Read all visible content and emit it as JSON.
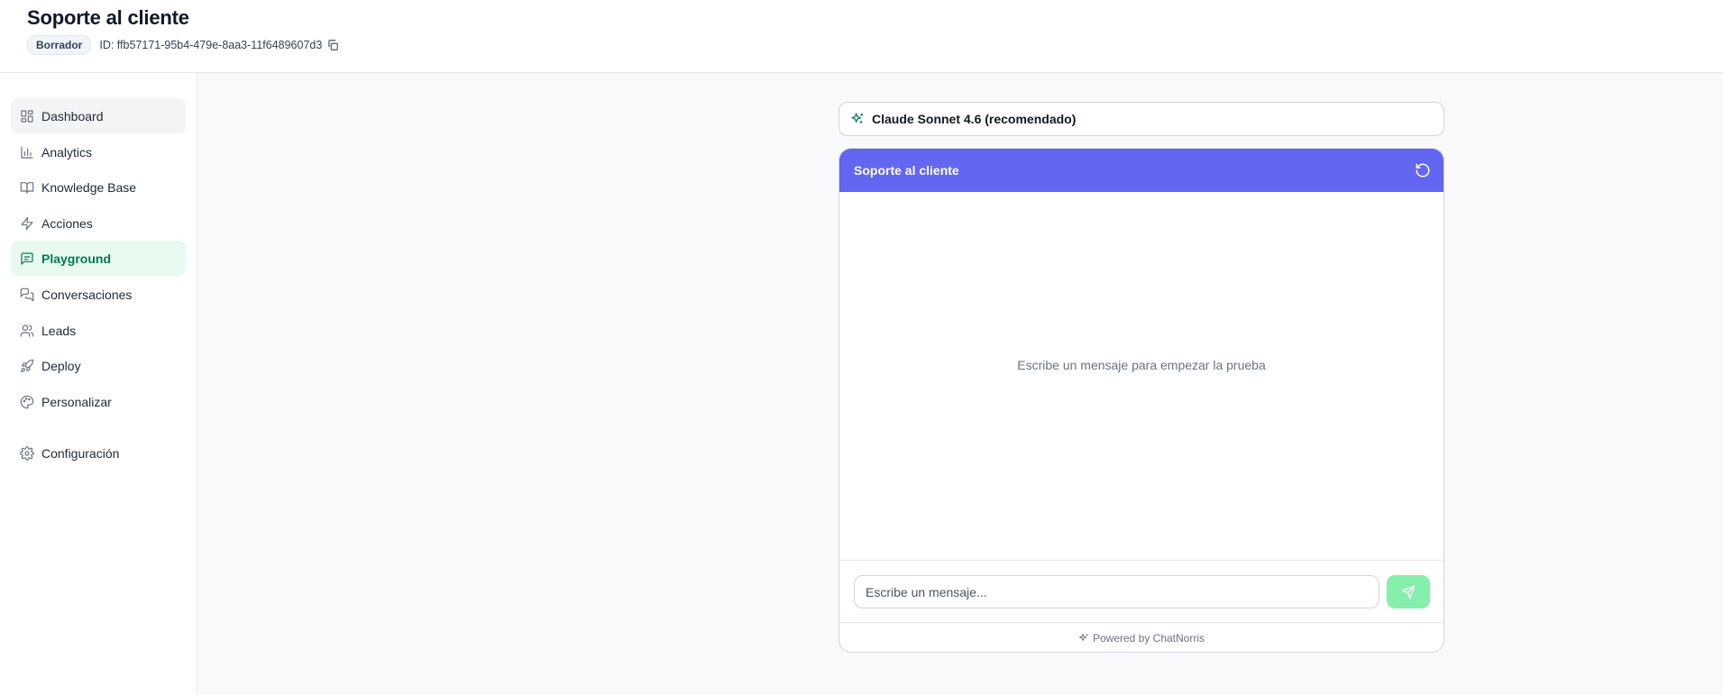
{
  "header": {
    "title": "Soporte al cliente",
    "status_badge": "Borrador",
    "id_text": "ID: ffb57171-95b4-479e-8aa3-11f6489607d3"
  },
  "sidebar": {
    "items": [
      {
        "label": "Dashboard",
        "icon": "dashboard-icon"
      },
      {
        "label": "Analytics",
        "icon": "bar-chart-icon"
      },
      {
        "label": "Knowledge Base",
        "icon": "book-icon"
      },
      {
        "label": "Acciones",
        "icon": "lightning-icon"
      },
      {
        "label": "Playground",
        "icon": "message-square-icon",
        "active": true
      },
      {
        "label": "Conversaciones",
        "icon": "messages-icon"
      },
      {
        "label": "Leads",
        "icon": "users-icon"
      },
      {
        "label": "Deploy",
        "icon": "rocket-icon"
      },
      {
        "label": "Personalizar",
        "icon": "palette-icon"
      },
      {
        "label": "Configuración",
        "icon": "gear-icon"
      }
    ]
  },
  "model_select": {
    "label": "Claude Sonnet 4.6 (recomendado)",
    "icon": "sparkles-icon"
  },
  "chat": {
    "title": "Soporte al cliente",
    "empty_message": "Escribe un mensaje para empezar la prueba",
    "input_placeholder": "Escribe un mensaje...",
    "footer": "Powered by ChatNorris"
  },
  "colors": {
    "accent_green": "#047857",
    "active_bg": "#e8faf0",
    "chat_header": "#6366f1",
    "send_button": "#86efac"
  }
}
